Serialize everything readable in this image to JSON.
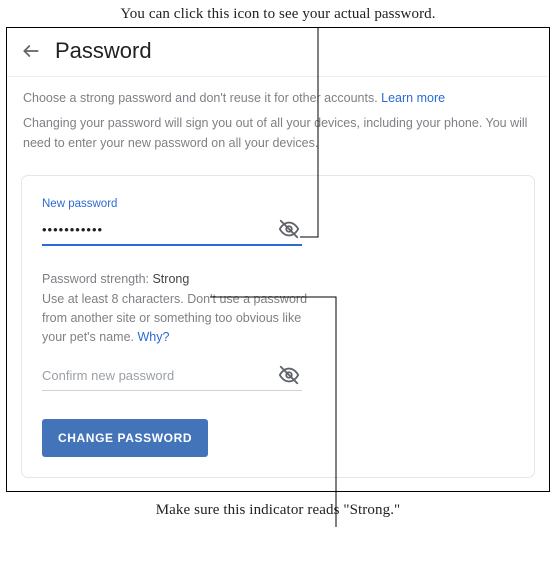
{
  "annotations": {
    "top": "You can click this icon to see your actual password.",
    "bottom": "Make sure this indicator reads \"Strong.\""
  },
  "header": {
    "title": "Password"
  },
  "intro": {
    "line1_pre": "Choose a strong password and don't reuse it for other accounts. ",
    "learn_more": "Learn more",
    "line2": "Changing your password will sign you out of all your devices, including your phone. You will need to enter your new password on all your devices."
  },
  "form": {
    "new_password_label": "New password",
    "new_password_value": "•••••••••••",
    "strength_label": "Password strength: ",
    "strength_value": "Strong",
    "tips_text": "Use at least 8 characters. Don't use a password from another site or something too obvious like your pet's name. ",
    "why": "Why?",
    "confirm_placeholder": "Confirm new password",
    "change_button": "CHANGE PASSWORD"
  }
}
